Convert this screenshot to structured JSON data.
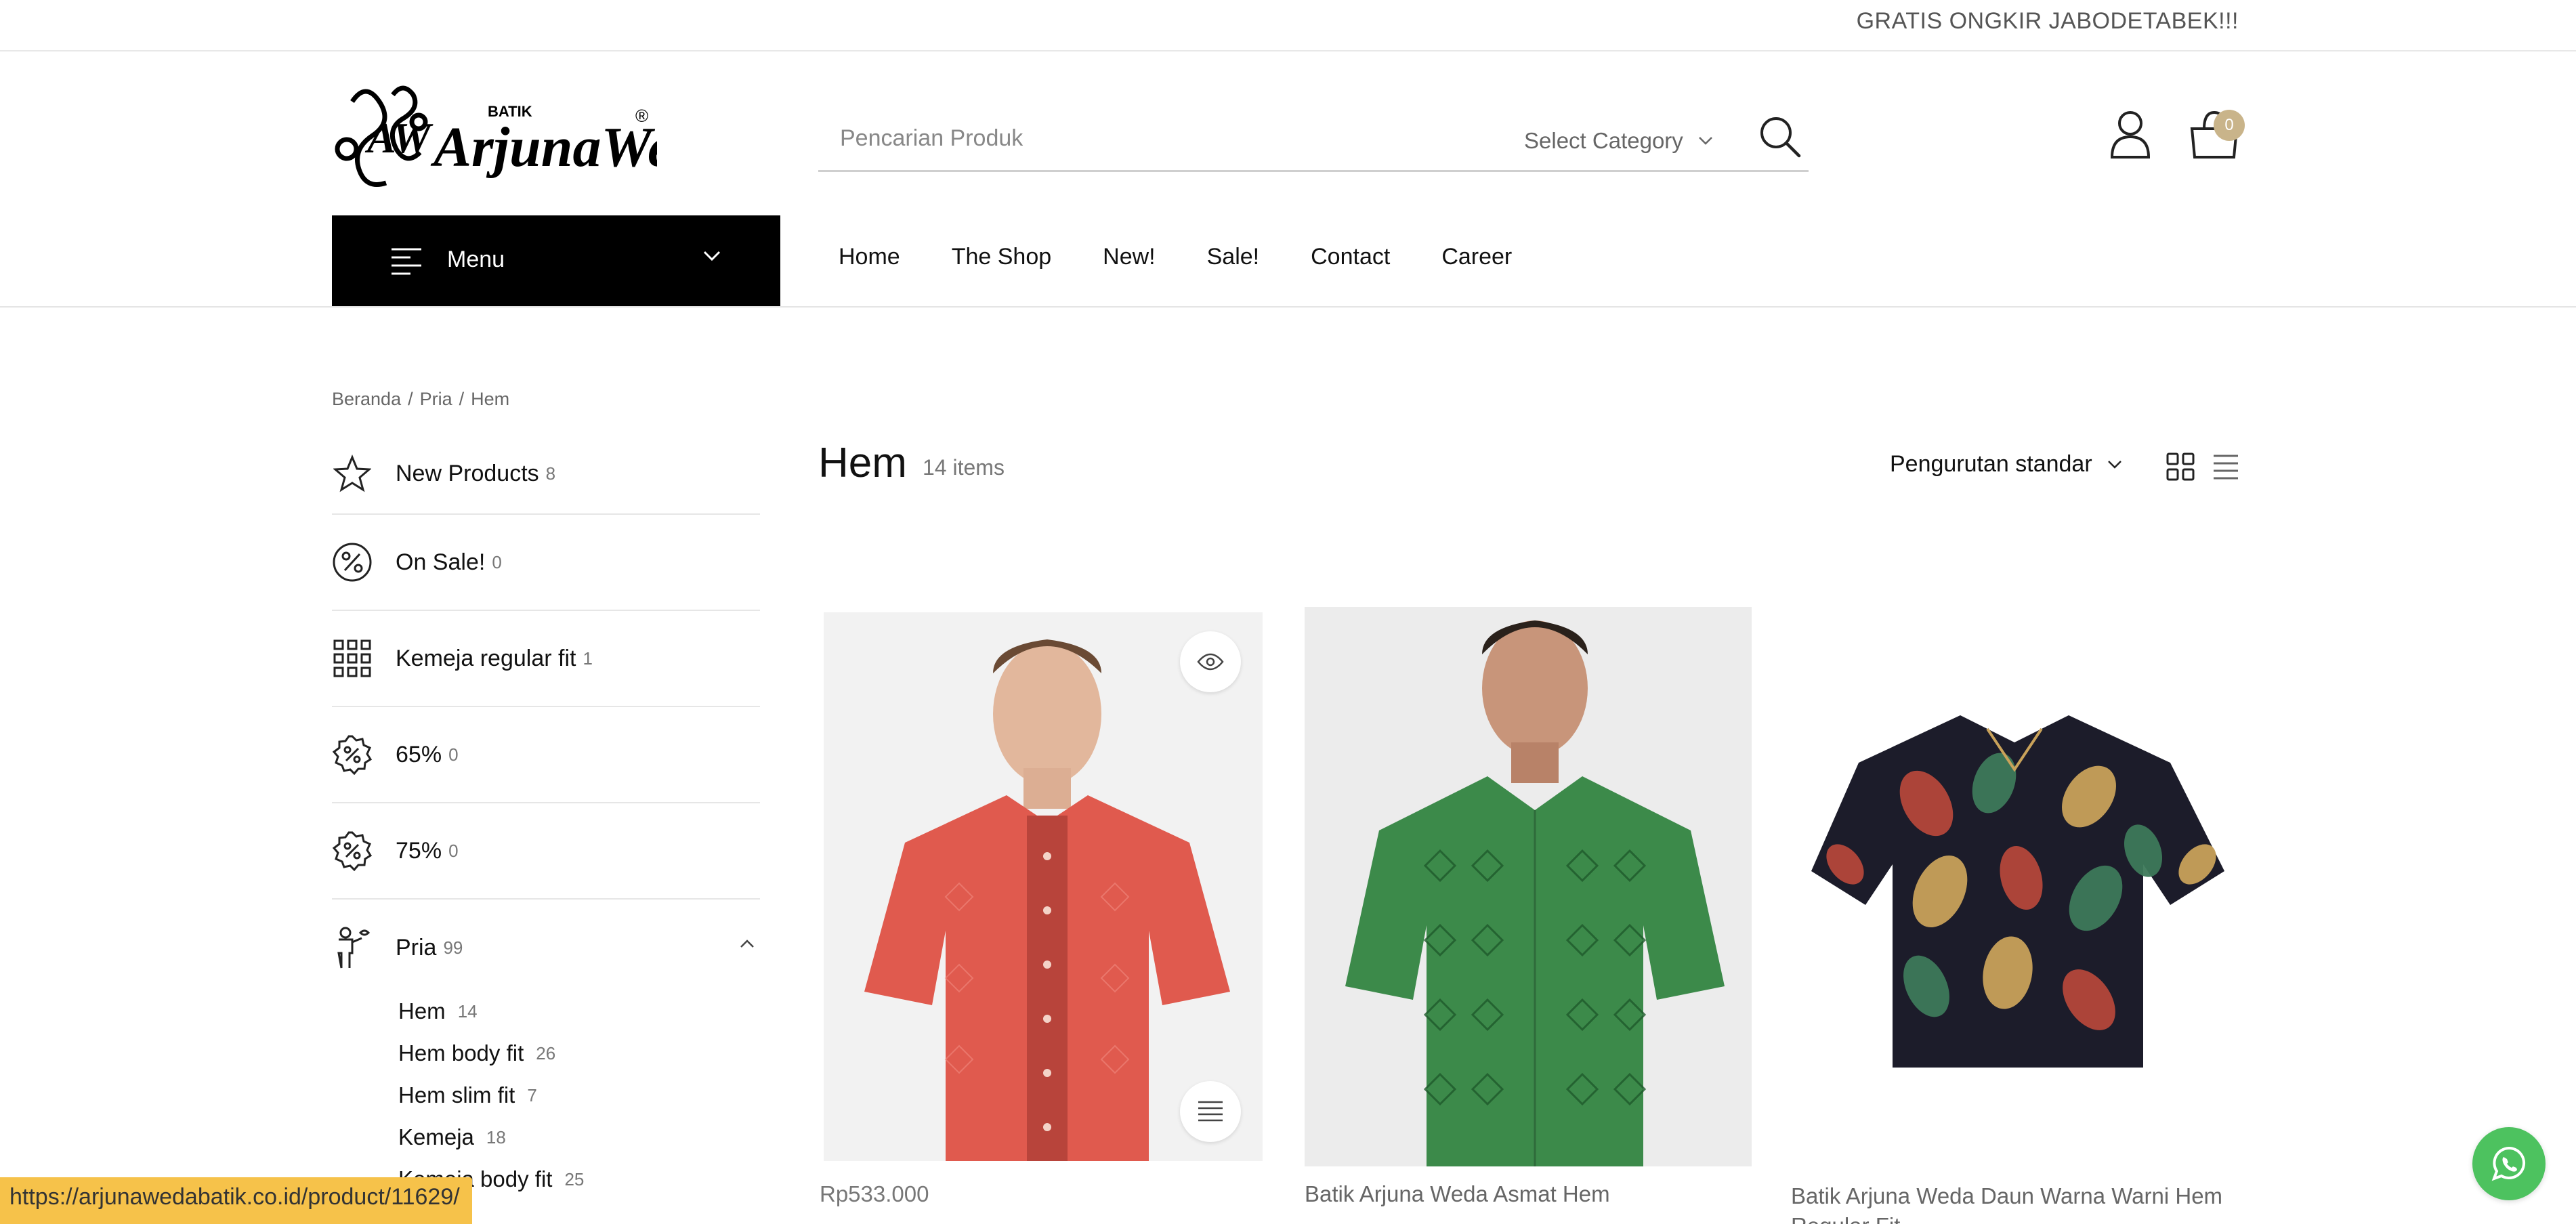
{
  "topbar": {
    "promo_text": "GRATIS ONGKIR JABODETABEK!!!"
  },
  "logo": {
    "small_text": "BATIK",
    "brand": "ArjunaWeda",
    "mark": "®",
    "icon": "batik-logo-ornament"
  },
  "search": {
    "placeholder": "Pencarian Produk",
    "category_label": "Select Category",
    "icon": "search-icon"
  },
  "header_icons": {
    "account_icon": "user-icon",
    "cart_icon": "bag-icon",
    "cart_count": "0",
    "badge_color": "#c9b48a"
  },
  "menu": {
    "label": "Menu"
  },
  "nav": {
    "items": [
      {
        "label": "Home"
      },
      {
        "label": "The Shop"
      },
      {
        "label": "New!"
      },
      {
        "label": "Sale!"
      },
      {
        "label": "Contact"
      },
      {
        "label": "Career"
      }
    ]
  },
  "breadcrumb": {
    "items": [
      "Beranda",
      "Pria",
      "Hem"
    ],
    "separator": "/"
  },
  "sidebar": {
    "items": [
      {
        "label": "New Products",
        "count": "8",
        "icon": "star-icon"
      },
      {
        "label": "On Sale!",
        "count": "0",
        "icon": "percent-circle-icon"
      },
      {
        "label": "Kemeja regular fit",
        "count": "1",
        "icon": "grid-icon"
      },
      {
        "label": "65%",
        "count": "0",
        "icon": "discount-badge-icon"
      },
      {
        "label": "75%",
        "count": "0",
        "icon": "discount-badge-icon"
      },
      {
        "label": "Pria",
        "count": "99",
        "icon": "man-icon"
      }
    ],
    "sub_items": [
      {
        "label": "Hem",
        "count": "14"
      },
      {
        "label": "Hem body fit",
        "count": "26"
      },
      {
        "label": "Hem slim fit",
        "count": "7"
      },
      {
        "label": "Kemeja",
        "count": "18"
      },
      {
        "label": "Kemeja body fit",
        "count": "25"
      }
    ]
  },
  "main": {
    "title": "Hem",
    "count": "14 items",
    "sort_label": "Pengurutan standar",
    "view_grid_icon": "grid-view-icon",
    "view_list_icon": "list-view-icon"
  },
  "products": [
    {
      "price": "Rp533.000",
      "shirt_color": "#e05a4e",
      "image": "red-batik-shirt"
    },
    {
      "name": "Batik Arjuna Weda Asmat Hem",
      "shirt_color": "#3c8a4a",
      "image": "green-batik-shirt"
    },
    {
      "name": "Batik Arjuna Weda Daun Warna Warni Hem Regular Fit",
      "shirt_color": "#1c1c2a",
      "image": "leaf-batik-shirt"
    }
  ],
  "status_bar": {
    "url": "https://arjunawedabatik.co.id/product/11629/"
  },
  "whatsapp": {
    "icon": "whatsapp-icon",
    "color": "#4dc25f"
  }
}
